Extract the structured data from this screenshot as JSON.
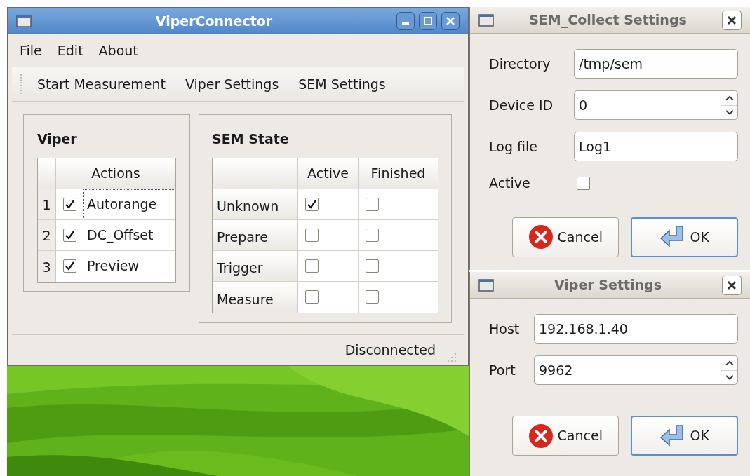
{
  "main_window": {
    "title": "ViperConnector",
    "menu": [
      "File",
      "Edit",
      "About"
    ],
    "toolbar": [
      "Start Measurement",
      "Viper Settings",
      "SEM Settings"
    ],
    "viper_group": {
      "title": "Viper",
      "columns": [
        "Actions"
      ],
      "rows": [
        {
          "number": "1",
          "label": "Autorange",
          "checked": true,
          "focused": true
        },
        {
          "number": "2",
          "label": "DC_Offset",
          "checked": true,
          "focused": false
        },
        {
          "number": "3",
          "label": "Preview",
          "checked": true,
          "focused": false
        }
      ]
    },
    "sem_group": {
      "title": "SEM State",
      "columns": [
        "Active",
        "Finished"
      ],
      "rows": [
        {
          "label": "Unknown",
          "active": true,
          "finished": false
        },
        {
          "label": "Prepare",
          "active": false,
          "finished": false
        },
        {
          "label": "Trigger",
          "active": false,
          "finished": false
        },
        {
          "label": "Measure",
          "active": false,
          "finished": false
        }
      ]
    },
    "status": "Disconnected"
  },
  "sem_dialog": {
    "title": "SEM_Collect Settings",
    "fields": [
      {
        "kind": "text",
        "label": "Directory",
        "value": "/tmp/sem"
      },
      {
        "kind": "spin",
        "label": "Device ID",
        "value": "0"
      },
      {
        "kind": "text",
        "label": "Log file",
        "value": "Log1"
      },
      {
        "kind": "checkbox",
        "label": "Active",
        "checked": false
      }
    ],
    "buttons": [
      {
        "kind": "cancel",
        "label": "Cancel"
      },
      {
        "kind": "ok",
        "label": "OK"
      }
    ]
  },
  "viper_dialog": {
    "title": "Viper Settings",
    "fields": [
      {
        "kind": "text",
        "label": "Host",
        "value": "192.168.1.40"
      },
      {
        "kind": "spin",
        "label": "Port",
        "value": "9962"
      }
    ],
    "buttons": [
      {
        "kind": "cancel",
        "label": "Cancel"
      },
      {
        "kind": "ok",
        "label": "OK"
      }
    ]
  }
}
